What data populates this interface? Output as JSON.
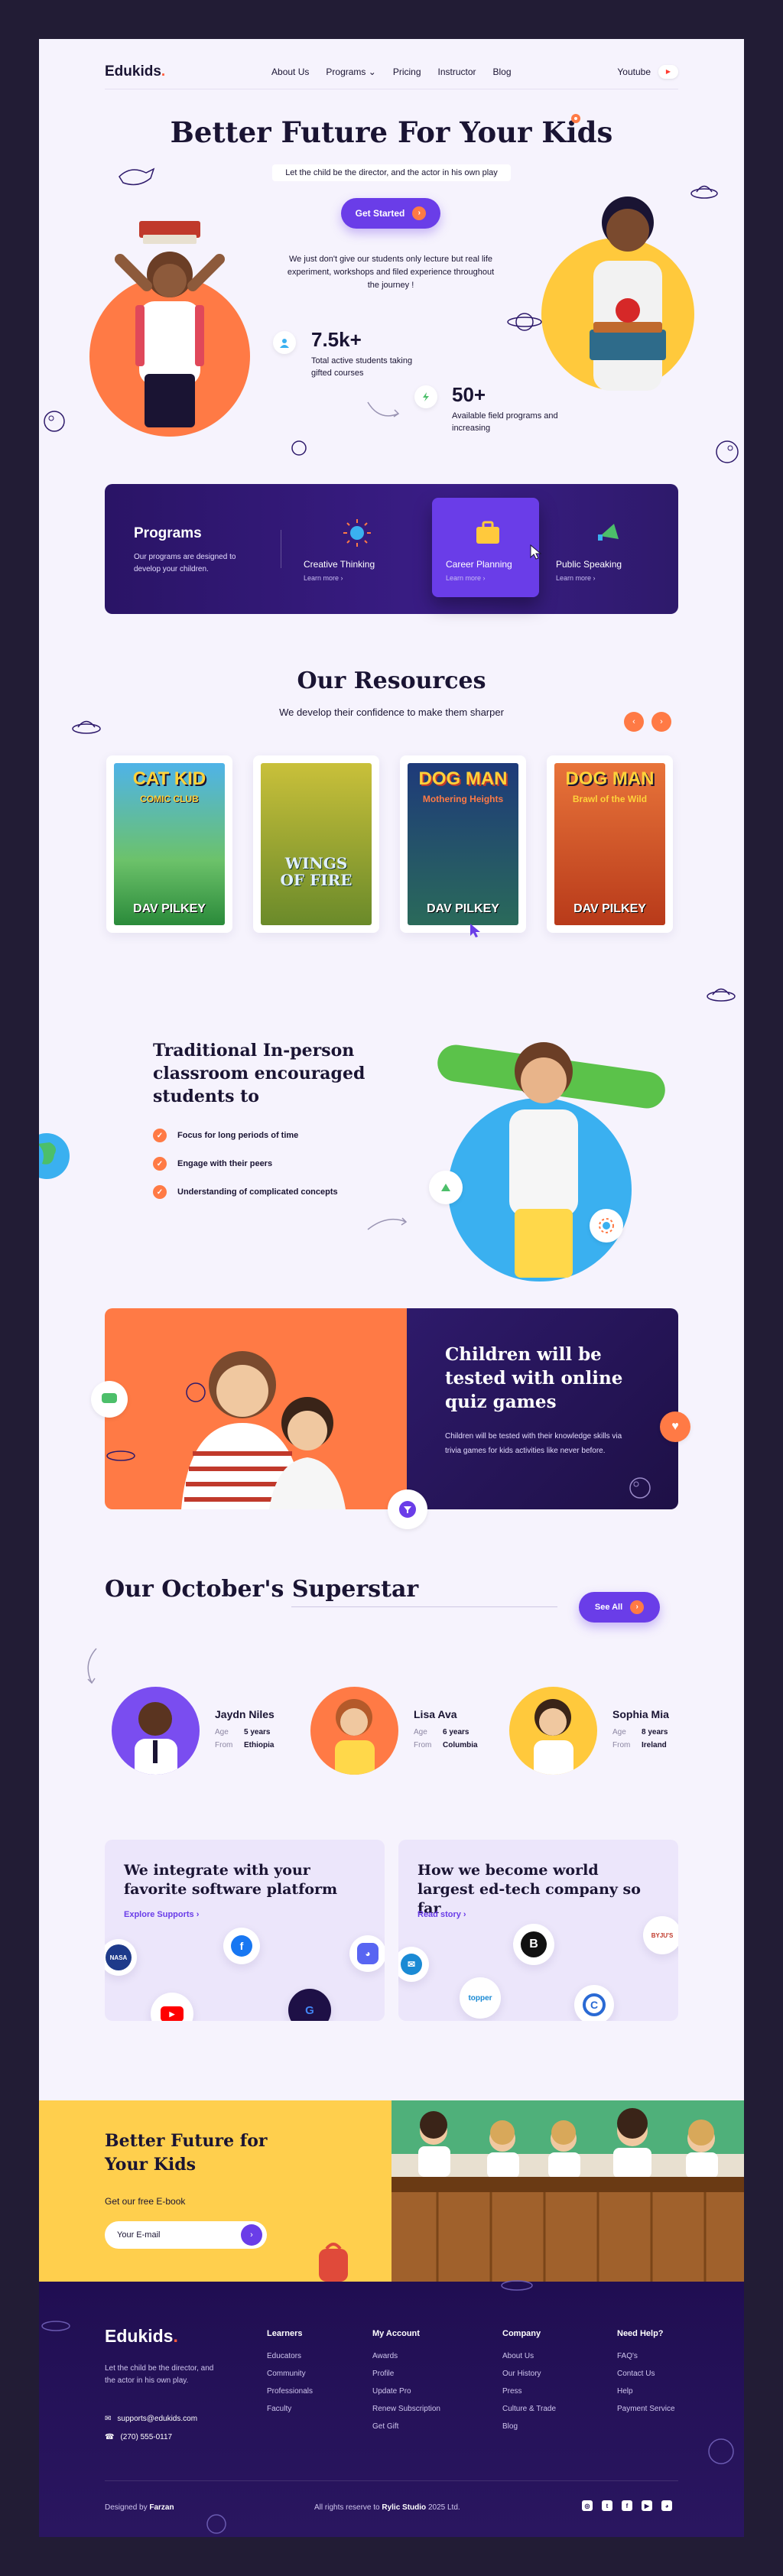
{
  "nav": {
    "logo": "Edukids",
    "links": [
      "About Us",
      "Programs",
      "Pricing",
      "Instructor",
      "Blog"
    ],
    "youtube": "Youtube"
  },
  "hero": {
    "title": "Better Future For Your Kids",
    "subtitle": "Let the child be the director, and the actor in his own play",
    "cta": "Get Started",
    "description": "We just don't give our students only lecture but real life experiment, workshops and filed experience throughout the journey !",
    "stat1": {
      "value": "7.5k+",
      "label": "Total active students taking gifted courses"
    },
    "stat2": {
      "value": "50+",
      "label": "Available field programs and increasing"
    }
  },
  "programs": {
    "title": "Programs",
    "description": "Our programs are designed to develop your children.",
    "learn_more": "Learn more",
    "items": [
      "Creative Thinking",
      "Career Planning",
      "Public Speaking"
    ]
  },
  "resources": {
    "title": "Our Resources",
    "subtitle": "We develop their confidence to make them sharper",
    "books": [
      {
        "title": "CAT KID",
        "subtitle": "COMIC CLUB",
        "author": "DAV PILKEY",
        "color": "#4fb3e8"
      },
      {
        "title": "WINGS OF FIRE",
        "subtitle": "",
        "author": "",
        "color": "#8fb03a"
      },
      {
        "title": "DOG MAN",
        "subtitle": "Mothering Heights",
        "author": "DAV PILKEY",
        "color": "#2a4a8a"
      },
      {
        "title": "DOG MAN",
        "subtitle": "Brawl of the Wild",
        "author": "DAV PILKEY",
        "color": "#d8552a"
      }
    ]
  },
  "traditional": {
    "title": "Traditional In-person classroom encouraged students to",
    "items": [
      "Focus for long periods of time",
      "Engage with their peers",
      "Understanding of complicated concepts"
    ]
  },
  "quiz": {
    "title": "Children will be tested with online quiz games",
    "description": "Children will be tested with their knowledge skills via trivia games for kids activities like never before."
  },
  "superstar": {
    "title": "Our October's Superstar",
    "see_all": "See All",
    "age_label": "Age",
    "from_label": "From",
    "students": [
      {
        "name": "Jaydn Niles",
        "age": "5 years",
        "from": "Ethiopia",
        "color": "#7a4df0"
      },
      {
        "name": "Lisa Ava",
        "age": "6 years",
        "from": "Columbia",
        "color": "#ff7a45"
      },
      {
        "name": "Sophia Mia",
        "age": "8 years",
        "from": "Ireland",
        "color": "#ffc93c"
      }
    ]
  },
  "integrate": {
    "card1": {
      "title": "We integrate with your favorite software platform",
      "link": "Explore Supports"
    },
    "card2": {
      "title": "How we become world largest ed-tech company so far",
      "link": "Read story"
    },
    "chips": {
      "nasa": "NASA",
      "topper": "topper",
      "byjus": "BYJU'S"
    }
  },
  "ebook": {
    "title": "Better Future for Your Kids",
    "subtitle": "Get our free E-book",
    "placeholder": "Your E-mail"
  },
  "footer": {
    "logo": "Edukids",
    "tagline": "Let the child be the director, and the actor in his own play.",
    "email": "supports@edukids.com",
    "phone": "(270) 555-0117",
    "columns": [
      {
        "heading": "Learners",
        "items": [
          "Educators",
          "Community",
          "Professionals",
          "Faculty"
        ]
      },
      {
        "heading": "My Account",
        "items": [
          "Awards",
          "Profile",
          "Update Pro",
          "Renew Subscription",
          "Get Gift"
        ]
      },
      {
        "heading": "Company",
        "items": [
          "About Us",
          "Our History",
          "Press",
          "Culture & Trade",
          "Blog"
        ]
      },
      {
        "heading": "Need Help?",
        "items": [
          "FAQ's",
          "Contact Us",
          "Help",
          "Payment Service"
        ]
      }
    ],
    "designed_by_label": "Designed by",
    "designer": "Farzan",
    "rights_prefix": "All rights reserve to",
    "studio": "Rylic Studio",
    "year": "2025 Ltd."
  },
  "colors": {
    "primary": "#6a3de8",
    "accent": "#ff7a45",
    "yellow": "#ffc93c",
    "dark": "#200e52"
  }
}
